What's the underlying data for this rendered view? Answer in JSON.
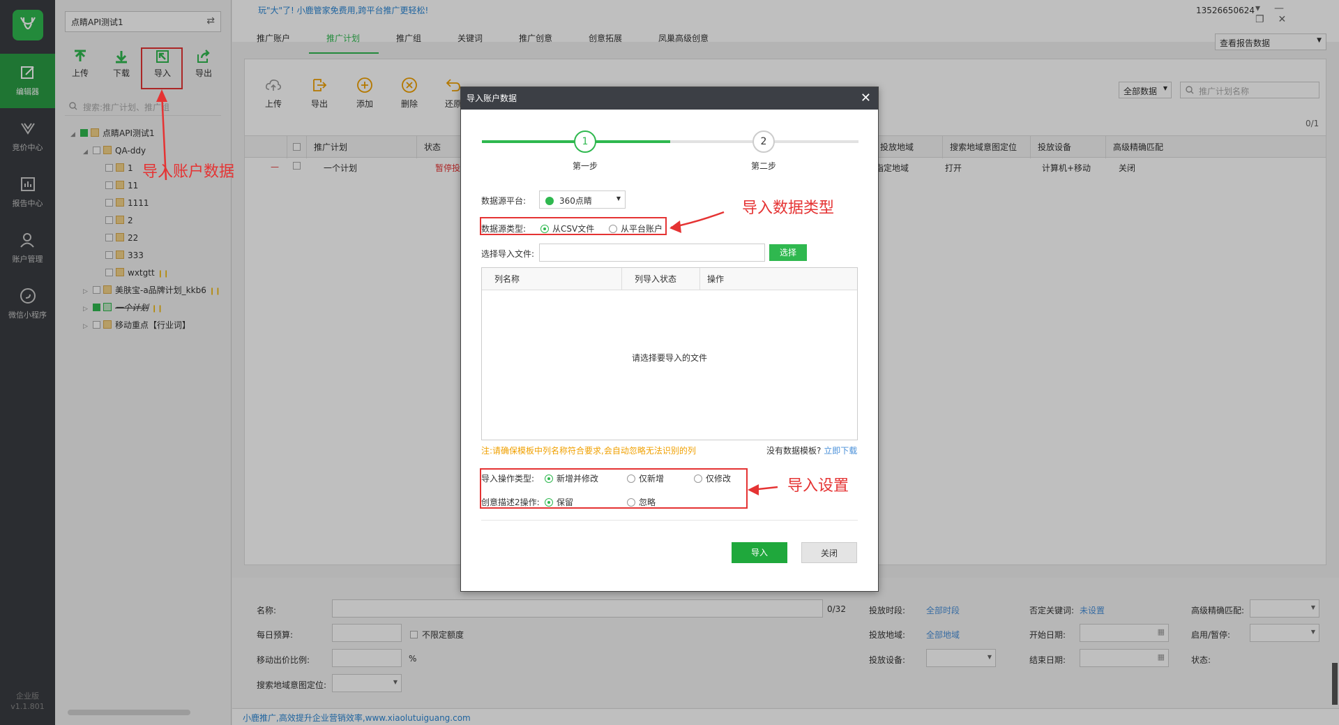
{
  "nav": {
    "items": [
      {
        "label": "编辑器",
        "icon": "edit-icon",
        "active": true
      },
      {
        "label": "竞价中心",
        "icon": "bid-icon"
      },
      {
        "label": "报告中心",
        "icon": "report-icon"
      },
      {
        "label": "账户管理",
        "icon": "user-icon"
      },
      {
        "label": "微信小程序",
        "icon": "wechat-mini-icon"
      }
    ],
    "edition": "企业版",
    "version": "v1.1.801"
  },
  "tree": {
    "account": "点睛API测试1",
    "toolbar": {
      "upload": "上传",
      "download": "下载",
      "import": "导入",
      "export": "导出"
    },
    "search_placeholder": "搜索:推广计划、推广组",
    "nodes": [
      "点睛API测试1",
      "QA-ddy",
      "1",
      "11",
      "1111",
      "2",
      "22",
      "333",
      "wxtgtt",
      "美肤宝-a品牌计划_kkb6",
      "一个计划",
      "移动重点【行业词】"
    ]
  },
  "annotations": {
    "import_account": "导入账户数据",
    "import_type": "导入数据类型",
    "import_settings": "导入设置"
  },
  "top": {
    "promo": "玩\"大\"了! 小鹿管家免费用,跨平台推广更轻松!",
    "phone": "13526650624",
    "tabs": [
      "推广账户",
      "推广计划",
      "推广组",
      "关键词",
      "推广创意",
      "创意拓展",
      "凤巢高级创意"
    ],
    "report_select": "查看报告数据"
  },
  "main": {
    "toolbar": {
      "upload": "上传",
      "export": "导出",
      "add": "添加",
      "delete": "删除",
      "restore": "还原"
    },
    "all_data": "全部数据",
    "search_placeholder": "推广计划名称",
    "page": "0/1",
    "columns": {
      "plan": "推广计划",
      "status": "状态",
      "region": "投放地域",
      "search_region": "搜索地域意图定位",
      "device": "投放设备",
      "adv_match": "高级精确匹配"
    },
    "row": {
      "minus": "—",
      "plan": "一个计划",
      "status": "暂停投",
      "region": "指定地域",
      "search_region": "打开",
      "device": "计算机+移动",
      "adv_match": "关闭"
    }
  },
  "form": {
    "name": "名称:",
    "name_count": "0/32",
    "daily_budget": "每日预算:",
    "unlimited": "不限定额度",
    "mobile_ratio": "移动出价比例:",
    "percent": "%",
    "search_region": "搜索地域意图定位:",
    "schedule": "投放时段:",
    "schedule_val": "全部时段",
    "region": "投放地域:",
    "region_val": "全部地域",
    "device": "投放设备:",
    "neg_kw": "否定关键词:",
    "neg_kw_val": "未设置",
    "start_date": "开始日期:",
    "end_date": "结束日期:",
    "adv_match": "高级精确匹配:",
    "enable_pause": "启用/暂停:",
    "status": "状态:"
  },
  "footer": "小鹿推广,高效提升企业营销效率,www.xiaolutuiguang.com",
  "modal": {
    "title": "导入账户数据",
    "step1_num": "1",
    "step1": "第一步",
    "step2_num": "2",
    "step2": "第二步",
    "platform_label": "数据源平台:",
    "platform_value": "360点睛",
    "source_type_label": "数据源类型:",
    "source_csv": "从CSV文件",
    "source_account": "从平台账户",
    "file_label": "选择导入文件:",
    "choose": "选择",
    "col_name": "列名称",
    "col_status": "列导入状态",
    "col_op": "操作",
    "empty": "请选择要导入的文件",
    "note": "注:请确保模板中列名称符合要求,会自动忽略无法识别的列",
    "no_template": "没有数据模板?",
    "download_now": "立即下载",
    "op_type_label": "导入操作类型:",
    "op_add_modify": "新增并修改",
    "op_add_only": "仅新增",
    "op_modify_only": "仅修改",
    "desc2_label": "创意描述2操作:",
    "desc2_keep": "保留",
    "desc2_ignore": "忽略",
    "ok": "导入",
    "close": "关闭"
  }
}
